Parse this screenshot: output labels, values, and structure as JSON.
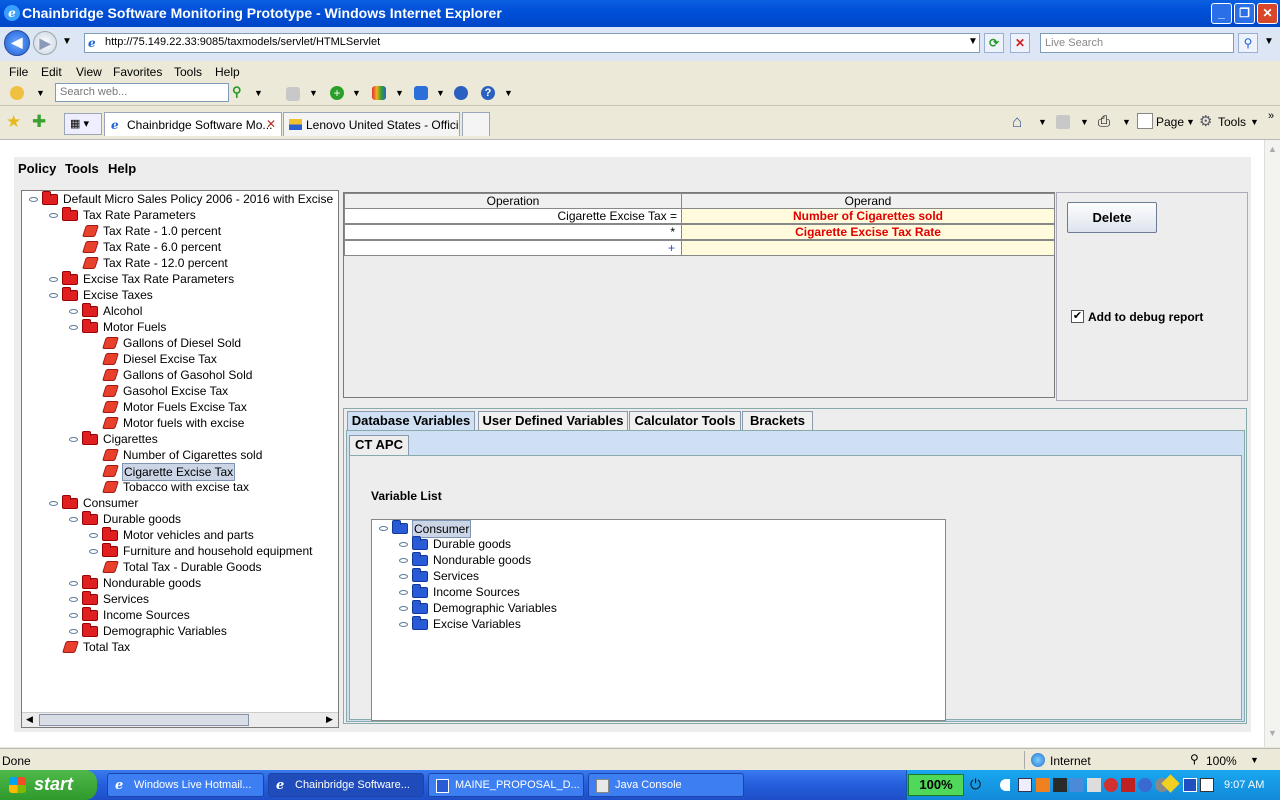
{
  "window": {
    "title": "Chainbridge Software Monitoring Prototype - Windows Internet Explorer"
  },
  "address_bar": {
    "url": "http://75.149.22.33:9085/taxmodels/servlet/HTMLServlet",
    "search_placeholder": "Live Search"
  },
  "menu": [
    "File",
    "Edit",
    "View",
    "Favorites",
    "Tools",
    "Help"
  ],
  "toolbar": {
    "search_placeholder": "Search web..."
  },
  "tabs": [
    {
      "label": "Chainbridge Software Mo...",
      "active": true
    },
    {
      "label": "Lenovo United States - Offici...",
      "active": false
    }
  ],
  "command_bar": {
    "page_label": "Page",
    "tools_label": "Tools"
  },
  "applet": {
    "menu": [
      "Policy",
      "Tools",
      "Help"
    ],
    "tree": [
      {
        "label": "Default Micro Sales Policy 2006 - 2016 with Excise",
        "type": "folder",
        "level": 0,
        "expanded": true
      },
      {
        "label": "Tax Rate Parameters",
        "type": "folder",
        "level": 1,
        "expanded": true
      },
      {
        "label": "Tax Rate - 1.0 percent",
        "type": "leaf",
        "level": 2
      },
      {
        "label": "Tax Rate - 6.0 percent",
        "type": "leaf",
        "level": 2
      },
      {
        "label": "Tax Rate - 12.0 percent",
        "type": "leaf",
        "level": 2
      },
      {
        "label": "Excise Tax Rate Parameters",
        "type": "folder",
        "level": 1,
        "expanded": false
      },
      {
        "label": "Excise Taxes",
        "type": "folder",
        "level": 1,
        "expanded": true
      },
      {
        "label": "Alcohol",
        "type": "folder",
        "level": 2,
        "expanded": false
      },
      {
        "label": "Motor Fuels",
        "type": "folder",
        "level": 2,
        "expanded": true
      },
      {
        "label": "Gallons of Diesel Sold",
        "type": "leaf",
        "level": 3
      },
      {
        "label": "Diesel Excise Tax",
        "type": "leaf",
        "level": 3
      },
      {
        "label": "Gallons of Gasohol Sold",
        "type": "leaf",
        "level": 3
      },
      {
        "label": "Gasohol Excise Tax",
        "type": "leaf",
        "level": 3
      },
      {
        "label": "Motor Fuels Excise Tax",
        "type": "leaf",
        "level": 3
      },
      {
        "label": "Motor fuels with excise",
        "type": "leaf",
        "level": 3
      },
      {
        "label": "Cigarettes",
        "type": "folder",
        "level": 2,
        "expanded": true
      },
      {
        "label": "Number of Cigarettes sold",
        "type": "leaf",
        "level": 3
      },
      {
        "label": "Cigarette Excise Tax",
        "type": "leaf",
        "level": 3,
        "selected": true
      },
      {
        "label": "Tobacco with excise tax",
        "type": "leaf",
        "level": 3
      },
      {
        "label": "Consumer",
        "type": "folder",
        "level": 1,
        "expanded": true
      },
      {
        "label": "Durable goods",
        "type": "folder",
        "level": 2,
        "expanded": true
      },
      {
        "label": "Motor vehicles and parts",
        "type": "folder",
        "level": 3,
        "expanded": false
      },
      {
        "label": "Furniture and household equipment",
        "type": "folder",
        "level": 3,
        "expanded": false
      },
      {
        "label": "Total Tax - Durable Goods",
        "type": "leaf",
        "level": 3
      },
      {
        "label": "Nondurable goods",
        "type": "folder",
        "level": 2,
        "expanded": false
      },
      {
        "label": "Services",
        "type": "folder",
        "level": 2,
        "expanded": false
      },
      {
        "label": "Income Sources",
        "type": "folder",
        "level": 2,
        "expanded": false
      },
      {
        "label": "Demographic Variables",
        "type": "folder",
        "level": 2,
        "expanded": false
      },
      {
        "label": "Total Tax",
        "type": "leaf",
        "level": 1
      }
    ],
    "operations": {
      "headers": [
        "Operation",
        "Operand"
      ],
      "rows": [
        {
          "operation": "Cigarette Excise Tax =",
          "operand": "Number of Cigarettes sold"
        },
        {
          "operation": "*",
          "operand": "Cigarette Excise Tax Rate"
        },
        {
          "operation": "+",
          "operand": ""
        }
      ]
    },
    "delete_label": "Delete",
    "debug_label": "Add to debug report",
    "debug_checked": true,
    "var_tabs": [
      "Database Variables",
      "User Defined Variables",
      "Calculator Tools",
      "Brackets"
    ],
    "sub_tab": "CT APC",
    "variable_list_label": "Variable List",
    "variables": [
      {
        "label": "Consumer",
        "level": 0,
        "expanded": true
      },
      {
        "label": "Durable goods",
        "level": 1
      },
      {
        "label": "Nondurable goods",
        "level": 1
      },
      {
        "label": "Services",
        "level": 1
      },
      {
        "label": "Income Sources",
        "level": 1
      },
      {
        "label": "Demographic Variables",
        "level": 1
      },
      {
        "label": "Excise Variables",
        "level": 1
      }
    ]
  },
  "status": {
    "text": "Done",
    "zone": "Internet",
    "zoom": "100%"
  },
  "taskbar": {
    "start": "start",
    "items": [
      {
        "label": "Windows Live Hotmail..."
      },
      {
        "label": "Chainbridge Software..."
      },
      {
        "label": "MAINE_PROPOSAL_D..."
      },
      {
        "label": "Java Console"
      }
    ],
    "battery": "100%",
    "clock": "9:07 AM"
  }
}
